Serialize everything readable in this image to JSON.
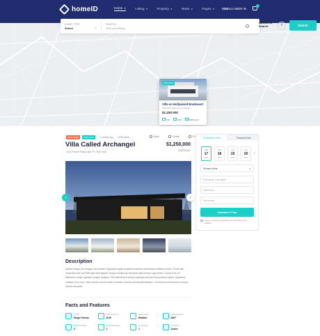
{
  "nav": {
    "logo": "homeID",
    "menu": [
      "Home",
      "Listing",
      "Property",
      "News",
      "Pages",
      "Contact"
    ],
    "right": {
      "currency": "ENG",
      "signin": "SIGN IN"
    }
  },
  "search": {
    "home_type_label": "HOME TYPE",
    "home_type_value": "Select",
    "search_label": "SEARCH",
    "search_placeholder": "Find something...",
    "advanced": "Advanced Search",
    "button": "Search"
  },
  "map_card": {
    "tag": "FOR SALE",
    "title": "Villa on Hollywood Boulevard",
    "address": "1421 San Pedro St, Los Angeles",
    "price": "$1,250.000",
    "beds": "3 Br",
    "baths": "3 Ba",
    "area": "2300 Sq.Ft"
  },
  "listing": {
    "tag_featured": "FEATURED",
    "tag_sale": "FOR SALE",
    "time": "2 months ago",
    "views": "1039 views",
    "save": "Save",
    "share": "Share",
    "print": "Print",
    "title": "Villa Called Archangel",
    "address": "1119 Pinnie Pass Lake, FL New York",
    "price": "$1,250,000",
    "sqft": "$1550/SqFt"
  },
  "description": {
    "heading": "Description",
    "text": "Massa tempor nec feugiat nisl pretium. Egestas fringilla phasellus faucibus scelerisque eleifend donec. Porta nibh venenatis cras sed felis eget velit aliquet. Neque volutpat ac tincidunt vitae semper quis lectus. Turpis in eu mi bibendum neque egestas congue quisque. Sed elementum tempus egestas sed sed risus pretium quam. Dignissim sodales ut eu sem. Nibh mauris cursus mattis molestie a iaculis at erat pellentesque. Id interdum velit laoreet id donec ultrices tincidunt."
  },
  "facts": {
    "heading": "Facts and Features",
    "items": [
      {
        "label": "TYPE",
        "value": "Single Family",
        "icon": "home-icon"
      },
      {
        "label": "YEAR BUILT",
        "value": "2019",
        "icon": "calendar-icon"
      },
      {
        "label": "HEATING",
        "value": "Radiant",
        "icon": "heat-icon"
      },
      {
        "label": "PRICE/SQFT",
        "value": "$287",
        "icon": "price-icon"
      },
      {
        "label": "BEDROOMS",
        "value": "3",
        "icon": "bed-icon"
      },
      {
        "label": "BATHROOMS",
        "value": "2",
        "icon": "bath-icon"
      },
      {
        "label": "GARAGE",
        "value": "1",
        "icon": "garage-icon"
      },
      {
        "label": "STATUS",
        "value": "Active",
        "icon": "status-icon"
      }
    ]
  },
  "sidebar": {
    "tab_tour": "Schedule A Tour",
    "tab_info": "Request Info",
    "dates": [
      {
        "dow": "WED",
        "day": "17",
        "mon": "NOV"
      },
      {
        "dow": "THU",
        "day": "18",
        "mon": "NOV"
      },
      {
        "dow": "FRI",
        "day": "19",
        "mon": "NOV"
      },
      {
        "dow": "SAT",
        "day": "20",
        "mon": "NOV"
      }
    ],
    "time_select": "Choose a time",
    "name_placeholder": "First Name, Last Name",
    "email_placeholder": "Your Email",
    "phone_placeholder": "Your phone",
    "button": "Schedule A Tour",
    "consent": "I agree to receive marketing communications and updates."
  },
  "colors": {
    "nav": "#1f2d6e",
    "accent": "#1ccdc8",
    "featured": "#e9734b"
  }
}
